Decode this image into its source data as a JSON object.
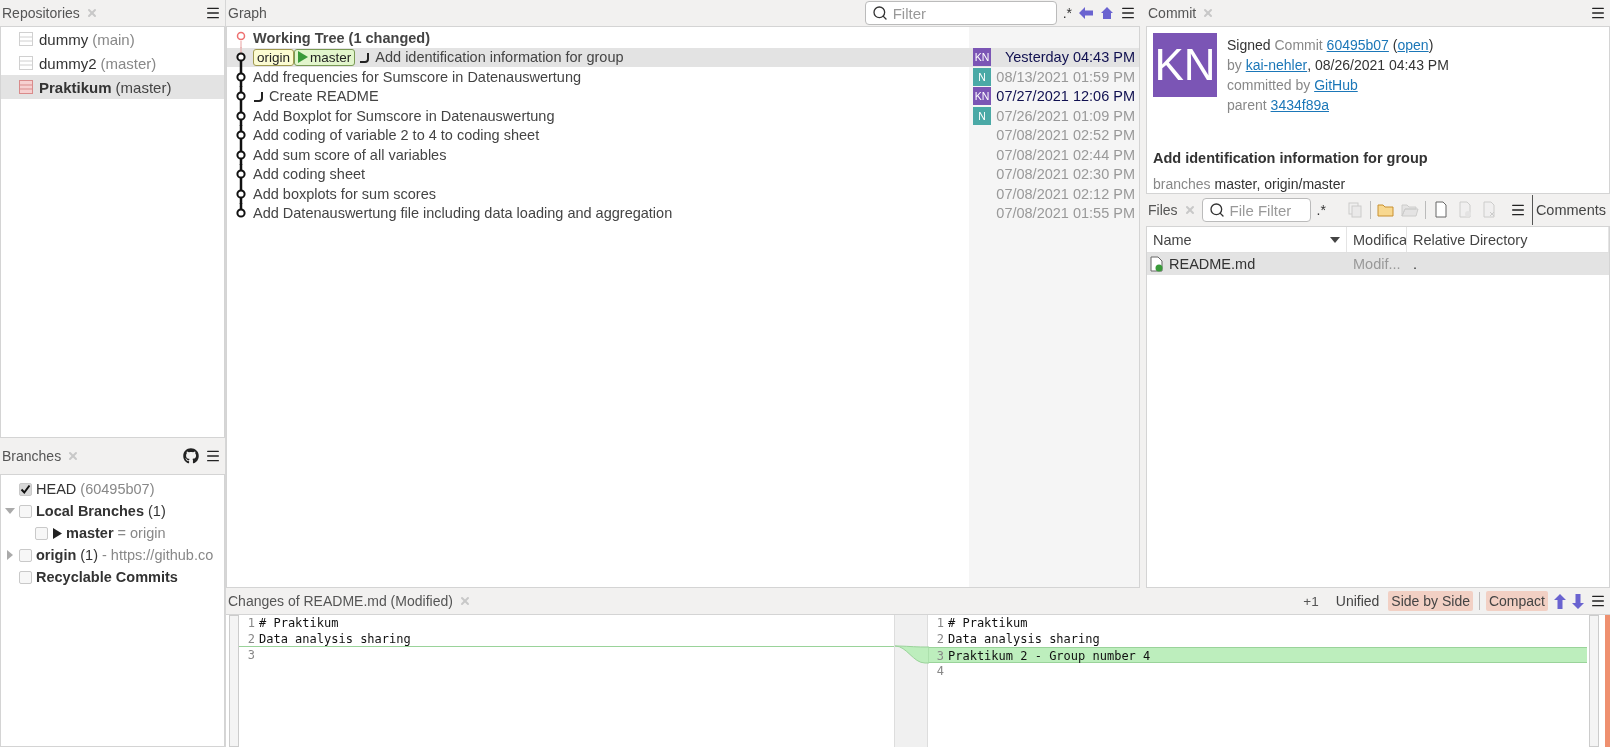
{
  "repositories": {
    "title": "Repositories",
    "items": [
      {
        "name": "dummy",
        "branch": "(main)",
        "selected": false
      },
      {
        "name": "dummy2",
        "branch": "(master)",
        "selected": false
      },
      {
        "name": "Praktikum",
        "branch": "(master)",
        "selected": true
      }
    ]
  },
  "branches": {
    "title": "Branches",
    "items": [
      {
        "kind": "head",
        "label": "HEAD",
        "count": "(60495b07)",
        "checked": true
      },
      {
        "kind": "section",
        "label": "Local Branches",
        "count": "(1)",
        "checked": false,
        "expanded": true,
        "children": [
          {
            "label": "master",
            "note": "= origin",
            "checked": false,
            "current": true
          }
        ]
      },
      {
        "kind": "section",
        "label": "origin",
        "count": "(1)",
        "note": "- https://github.co",
        "checked": false,
        "expanded": false
      },
      {
        "kind": "section",
        "label": "Recyclable Commits",
        "checked": false
      }
    ]
  },
  "graph": {
    "title": "Graph",
    "filter": {
      "placeholder": "Filter"
    },
    "regex": ".*",
    "rows": [
      {
        "kind": "working",
        "message": "Working Tree (1 changed)",
        "selected": false
      },
      {
        "kind": "commit",
        "refs": [
          {
            "label": "origin",
            "kind": "remote",
            "current": false
          },
          {
            "label": "master",
            "kind": "local",
            "current": true
          }
        ],
        "hook": true,
        "message": "Add identification information for group",
        "author": "KN",
        "color": "#7b55b5",
        "date": "Yesterday 04:43 PM",
        "highlighted": true,
        "selected": true
      },
      {
        "kind": "commit",
        "hook": false,
        "message": "Add frequencies for Sumscore in Datenauswertung",
        "author": "N",
        "color": "#4aa9a6",
        "date": "08/13/2021 01:59 PM",
        "highlighted": false,
        "selected": false
      },
      {
        "kind": "commit",
        "hook": true,
        "message": "Create README",
        "author": "KN",
        "color": "#7b55b5",
        "date": "07/27/2021 12:06 PM",
        "highlighted": true,
        "selected": false
      },
      {
        "kind": "commit",
        "hook": false,
        "message": "Add Boxplot for Sumscore in Datenauswertung",
        "author": "N",
        "color": "#4aa9a6",
        "date": "07/26/2021 01:09 PM",
        "highlighted": false,
        "selected": false
      },
      {
        "kind": "commit",
        "hook": false,
        "message": "Add coding of variable 2 to 4 to coding sheet",
        "date": "07/08/2021 02:52 PM",
        "highlighted": false,
        "selected": false
      },
      {
        "kind": "commit",
        "hook": false,
        "message": "Add sum score of all variables",
        "date": "07/08/2021 02:44 PM",
        "highlighted": false,
        "selected": false
      },
      {
        "kind": "commit",
        "hook": false,
        "message": "Add coding sheet",
        "date": "07/08/2021 02:30 PM",
        "highlighted": false,
        "selected": false
      },
      {
        "kind": "commit",
        "hook": false,
        "message": "Add boxplots for sum scores",
        "date": "07/08/2021 02:12 PM",
        "highlighted": false,
        "selected": false
      },
      {
        "kind": "commit",
        "hook": false,
        "message": "Add Datenauswertung file including data loading and aggregation",
        "date": "07/08/2021 01:55 PM",
        "highlighted": false,
        "selected": false
      }
    ]
  },
  "commit": {
    "title": "Commit",
    "avatar": {
      "initials": "KN",
      "color": "#7b55b5"
    },
    "lines": [
      [
        {
          "kind": "strong",
          "text": "Signed "
        },
        {
          "kind": "label",
          "text": "Commit "
        },
        {
          "kind": "link",
          "text": "60495b07"
        },
        {
          "kind": "plain",
          "text": " ("
        },
        {
          "kind": "link",
          "text": "open"
        },
        {
          "kind": "plain",
          "text": ")"
        }
      ],
      [
        {
          "kind": "label",
          "text": "by "
        },
        {
          "kind": "link",
          "text": "kai-nehler"
        },
        {
          "kind": "plain",
          "text": ", 08/26/2021 04:43 PM"
        }
      ],
      [
        {
          "kind": "label",
          "text": "committed by "
        },
        {
          "kind": "link",
          "text": "GitHub"
        }
      ],
      [
        {
          "kind": "label",
          "text": "parent "
        },
        {
          "kind": "link",
          "text": "3434f89a"
        }
      ]
    ],
    "message": "Add identification information for group",
    "branches_line": [
      {
        "kind": "label",
        "text": "branches "
      },
      {
        "kind": "plain",
        "text": "master, origin/master"
      }
    ]
  },
  "files": {
    "title": "Files",
    "filter": {
      "placeholder": "File Filter"
    },
    "regex": ".*",
    "tools": [
      {
        "kind": "stage",
        "disabled": true
      },
      {
        "kind": "sep"
      },
      {
        "kind": "folder",
        "disabled": false
      },
      {
        "kind": "folder-open",
        "disabled": true
      },
      {
        "kind": "sep"
      },
      {
        "kind": "file",
        "disabled": false
      },
      {
        "kind": "file-add",
        "disabled": true
      },
      {
        "kind": "file-remove",
        "disabled": true
      }
    ],
    "comments_tab": "Comments",
    "columns": [
      "Name",
      "Modifica",
      "Relative Directory"
    ],
    "rows": [
      {
        "name": "README.md",
        "state": "Modif...",
        "directory": ".",
        "selected": true
      }
    ]
  },
  "diff": {
    "title": "Changes of README.md (Modified)",
    "count": "+1",
    "views": [
      {
        "label": "Unified",
        "selected": false
      },
      {
        "label": "Side by Side",
        "selected": true
      }
    ],
    "compact": {
      "label": "Compact",
      "on": true
    },
    "left": [
      {
        "number": "1",
        "text": "# Praktikum",
        "added": false
      },
      {
        "number": "2",
        "text": "Data analysis sharing",
        "added": false
      },
      {
        "number": "3",
        "added": false
      }
    ],
    "right": [
      {
        "number": "1",
        "text": "# Praktikum",
        "added": false
      },
      {
        "number": "2",
        "text": "Data analysis sharing",
        "added": false
      },
      {
        "number": "3",
        "text": "Praktikum 2 - Group number 4",
        "added": true
      },
      {
        "number": "4",
        "added": false
      }
    ]
  }
}
